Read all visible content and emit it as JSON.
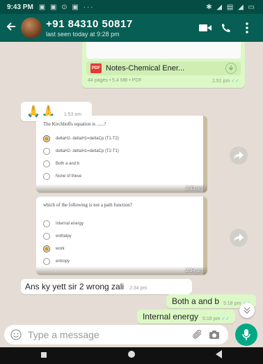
{
  "status_bar": {
    "time": "9:43 PM",
    "system_icons": "▣ ▣ ⊙ ▣ ···",
    "right_icons": "✱ ◢ ▤ ◢ ▭"
  },
  "header": {
    "contact_name": "+91 84310 50817",
    "last_seen": "last seen today at 9:28 pm"
  },
  "messages": {
    "document": {
      "pdf_tag": "PDF",
      "file_name": "Notes-Chemical Ener...",
      "meta": "44 pages • 5.4 MB • PDF",
      "time": "1:51 pm",
      "tick": "✓✓"
    },
    "emoji_msg": {
      "content": "🙏🙏",
      "time": "1:53 pm"
    },
    "poll1": {
      "question": "The Kirchhoffs equation is ......?",
      "options": [
        {
          "label": "deltaH2- deltaH1=deltaCp (T1-T2)",
          "selected": true
        },
        {
          "label": "deltaH2- deltaH1=deltaCp (T2-T1)",
          "selected": false
        },
        {
          "label": "Both a and b",
          "selected": false
        },
        {
          "label": "None of these",
          "selected": false
        }
      ],
      "time": "2:33 pm"
    },
    "poll2": {
      "question": "which of the following is not a path function?",
      "options": [
        {
          "label": "Internal energy",
          "selected": false
        },
        {
          "label": "enthalpy",
          "selected": false
        },
        {
          "label": "work",
          "selected": true
        },
        {
          "label": "entropy",
          "selected": false
        }
      ],
      "time": "2:34 pm"
    },
    "reply": {
      "text": "Ans ky yett sir 2 wrong zali",
      "time": "2:34 pm"
    },
    "answer1": {
      "text": "Both a and b",
      "time": "5:18 pm",
      "tick": "✓✓"
    },
    "answer2": {
      "text": "Internal energy",
      "time": "5:18 pm",
      "tick": "✓✓"
    }
  },
  "composer": {
    "placeholder": "Type a message"
  },
  "icons": [
    "back-arrow-icon",
    "video-call-icon",
    "voice-call-icon",
    "more-options-icon",
    "forward-icon",
    "emoji-icon",
    "attach-icon",
    "camera-icon",
    "mic-icon",
    "scroll-down-icon"
  ],
  "colors": {
    "header": "#075e54",
    "outgoing": "#dcf8c6",
    "background": "#e5ddd5",
    "accent": "#00a884"
  }
}
